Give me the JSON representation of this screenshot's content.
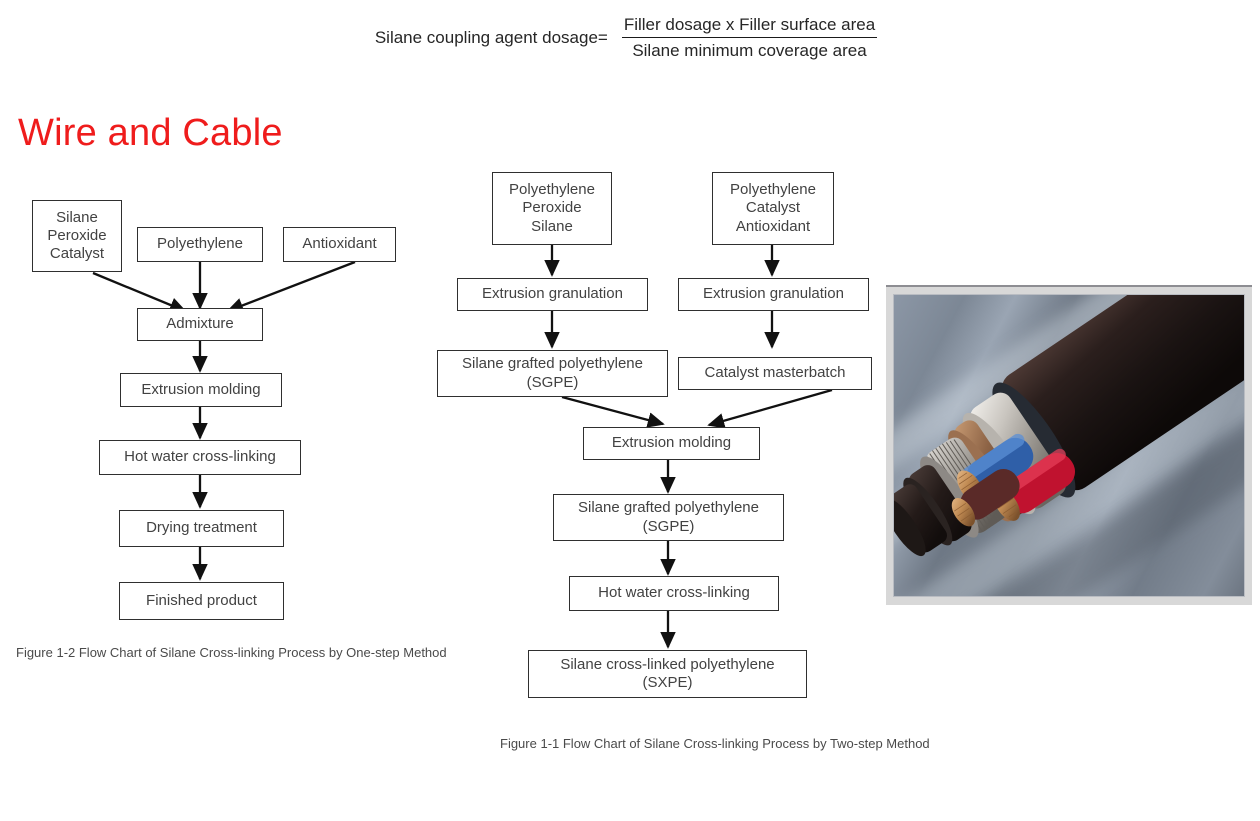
{
  "formula": {
    "lhs": "Silane coupling agent dosage=",
    "numerator": "Filler dosage x Filler surface area",
    "denominator": "Silane minimum coverage area"
  },
  "page_title": "Wire and Cable",
  "colors": {
    "title": "#ef1c1c",
    "box_border": "#2f2f2f",
    "box_text": "#424242",
    "arrow": "#111111",
    "caption": "#4a4a4a",
    "photo_mat": "#d8d8d8"
  },
  "one_step_chart": {
    "caption": "Figure 1-2 Flow Chart of Silane Cross-linking Process by One-step Method",
    "nodes": [
      {
        "id": "silane-peroxide-catalyst",
        "lines": [
          "Silane",
          "Peroxide",
          "Catalyst"
        ]
      },
      {
        "id": "polyethylene",
        "lines": [
          "Polyethylene"
        ]
      },
      {
        "id": "antioxidant",
        "lines": [
          "Antioxidant"
        ]
      },
      {
        "id": "admixture",
        "lines": [
          "Admixture"
        ]
      },
      {
        "id": "extrusion-molding",
        "lines": [
          "Extrusion molding"
        ]
      },
      {
        "id": "hot-water-cross-linking",
        "lines": [
          "Hot water cross-linking"
        ]
      },
      {
        "id": "drying-treatment",
        "lines": [
          "Drying treatment"
        ]
      },
      {
        "id": "finished-product",
        "lines": [
          "Finished product"
        ]
      }
    ]
  },
  "two_step_chart": {
    "caption": "Figure 1-1 Flow Chart of Silane Cross-linking Process by Two-step Method",
    "nodes": [
      {
        "id": "pe-peroxide-silane",
        "lines": [
          "Polyethylene",
          "Peroxide",
          "Silane"
        ]
      },
      {
        "id": "pe-catalyst-antioxidant",
        "lines": [
          "Polyethylene",
          "Catalyst",
          "Antioxidant"
        ]
      },
      {
        "id": "extrusion-granulation-left",
        "lines": [
          "Extrusion granulation"
        ]
      },
      {
        "id": "extrusion-granulation-right",
        "lines": [
          "Extrusion granulation"
        ]
      },
      {
        "id": "sgpe-upper",
        "lines": [
          "Silane grafted polyethylene",
          "(SGPE)"
        ]
      },
      {
        "id": "catalyst-masterbatch",
        "lines": [
          "Catalyst masterbatch"
        ]
      },
      {
        "id": "extrusion-molding",
        "lines": [
          "Extrusion molding"
        ]
      },
      {
        "id": "sgpe-lower",
        "lines": [
          "Silane grafted polyethylene",
          "(SGPE)"
        ]
      },
      {
        "id": "hot-water-cross-linking",
        "lines": [
          "Hot water cross-linking"
        ]
      },
      {
        "id": "sxpe",
        "lines": [
          "Silane cross-linked polyethylene",
          "(SXPE)"
        ]
      }
    ]
  },
  "photo": {
    "name": "multi-core-power-cable-cutaway-photo",
    "description": "Cut-away view of an armored three-core power cable showing copper conductors and layered insulation"
  }
}
